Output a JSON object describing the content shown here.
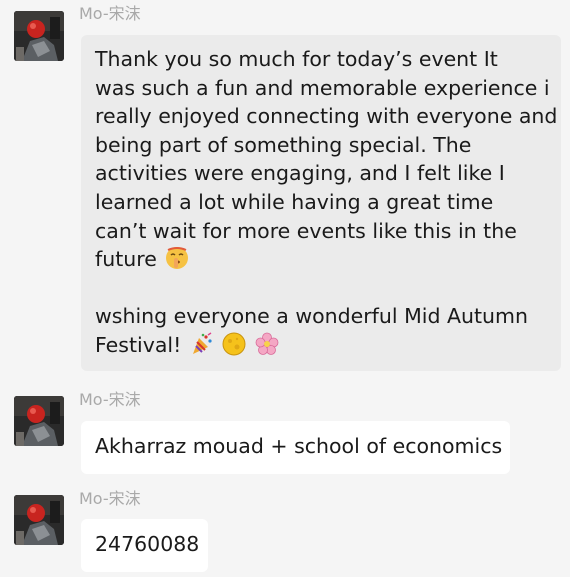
{
  "messages": [
    {
      "sender": "Mo-宋沫",
      "avatar_icon": "profile-photo",
      "lines": [
        "Thank you so much for today’s event  It",
        "was such a fun and memorable experience i",
        "really enjoyed connecting with everyone and",
        "being part of something special. The",
        "activities were engaging, and I felt like I",
        "learned a lot while having a great time",
        "can’t wait for more events like this in the",
        "future",
        "",
        "wshing everyone a wonderful Mid Autumn",
        "Festival!"
      ],
      "emojis": {
        "future_line": "shushing-face-emoji",
        "festival_line": [
          "party-popper-emoji",
          "full-moon-emoji",
          "cherry-blossom-emoji"
        ]
      }
    },
    {
      "sender": "Mo-宋沫",
      "avatar_icon": "profile-photo",
      "lines": [
        "Akharraz mouad + school of economics"
      ]
    },
    {
      "sender": "Mo-宋沫",
      "avatar_icon": "profile-photo",
      "lines": [
        "24760088"
      ]
    }
  ],
  "colors": {
    "background": "#f5f5f5",
    "bubble_grey": "#ebebeb",
    "bubble_white": "#ffffff",
    "sender_name": "#a9a9a9",
    "text": "#1a1a1a"
  }
}
